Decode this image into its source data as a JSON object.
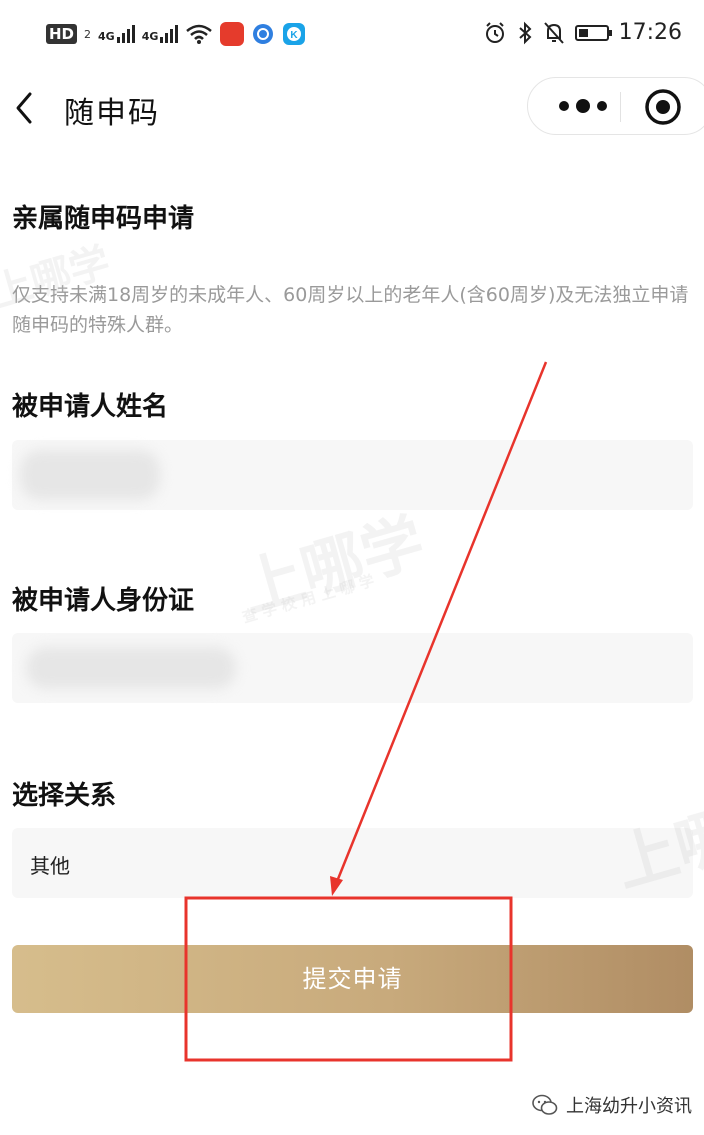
{
  "status_bar": {
    "hd": "HD",
    "hd_sub": "2",
    "net1": "4G",
    "net2": "4G",
    "time": "17:26",
    "battery_level": 0.35
  },
  "nav": {
    "title": "随申码"
  },
  "form": {
    "heading": "亲属随申码申请",
    "notice": "仅支持未满18周岁的未成年人、60周岁以上的老年人(含60周岁)及无法独立申请随申码的特殊人群。",
    "name_label": "被申请人姓名",
    "id_label": "被申请人身份证",
    "relation_label": "选择关系",
    "relation_value": "其他",
    "submit_label": "提交申请"
  },
  "watermarks": {
    "brand": "上哪学",
    "sub": "查 学 校   用 上 哪 学"
  },
  "footer": {
    "credit": "上海幼升小资讯"
  },
  "colors": {
    "annotation_red": "#e8342c",
    "submit_gradient_start": "#d6bd8c",
    "submit_gradient_end": "#b08d64"
  }
}
